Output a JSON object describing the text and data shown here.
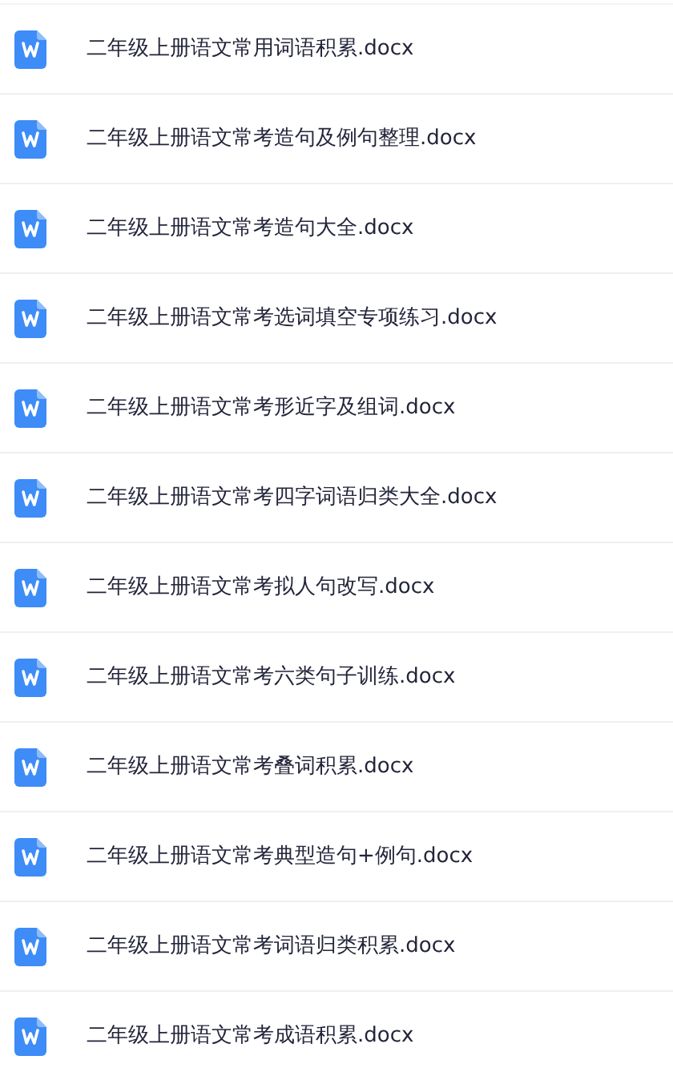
{
  "files": [
    {
      "name": "二年级上册语文常用词语积累.docx"
    },
    {
      "name": "二年级上册语文常考造句及例句整理.docx"
    },
    {
      "name": "二年级上册语文常考造句大全.docx"
    },
    {
      "name": "二年级上册语文常考选词填空专项练习.docx"
    },
    {
      "name": "二年级上册语文常考形近字及组词.docx"
    },
    {
      "name": "二年级上册语文常考四字词语归类大全.docx"
    },
    {
      "name": "二年级上册语文常考拟人句改写.docx"
    },
    {
      "name": "二年级上册语文常考六类句子训练.docx"
    },
    {
      "name": "二年级上册语文常考叠词积累.docx"
    },
    {
      "name": "二年级上册语文常考典型造句+例句.docx"
    },
    {
      "name": "二年级上册语文常考词语归类积累.docx"
    },
    {
      "name": "二年级上册语文常考成语积累.docx"
    }
  ]
}
